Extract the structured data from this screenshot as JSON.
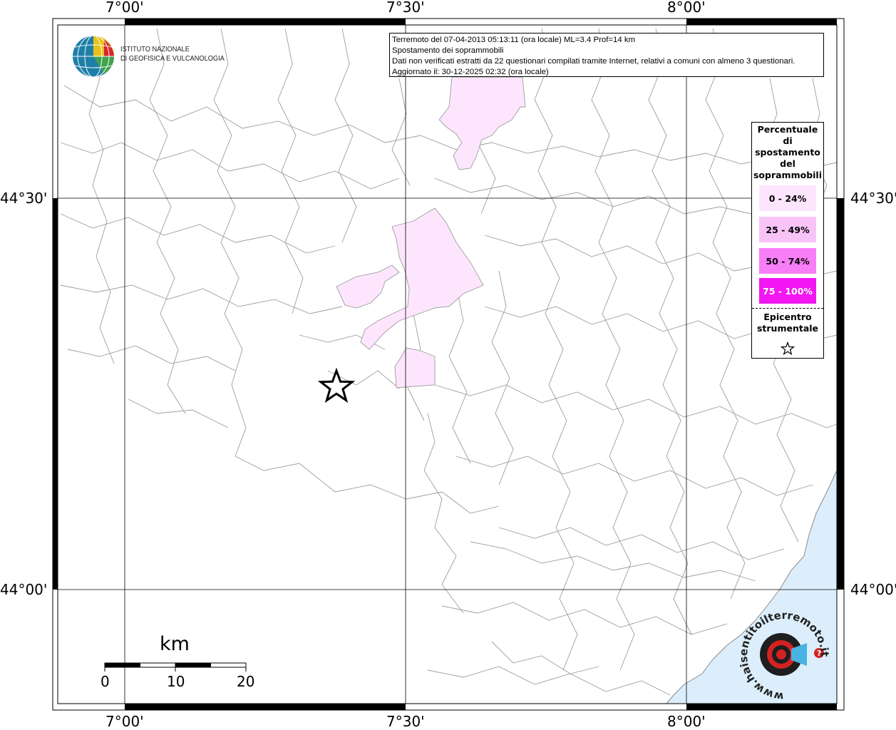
{
  "info": {
    "line1": "Terremoto del 07-04-2013 05:13:11 (ora locale) ML=3.4 Prof=14 km",
    "line2": "Spostamento dei soprammobili",
    "line3": "Dati non verificati estratti da 22 questionari compilati tramite Internet, relativi a comuni con almeno 3 questionari.",
    "line4": "Aggiornato il: 30-12-2025 02:32 (ora locale)"
  },
  "institute": {
    "line1": "ISTITUTO NAZIONALE",
    "line2": "DI GEOFISICA E VULCANOLOGIA"
  },
  "axes": {
    "top_lon": [
      "7°00'",
      "7°30'",
      "8°00'"
    ],
    "bottom_lon": [
      "7°00'",
      "7°30'",
      "8°00'"
    ],
    "left_lat": [
      "44°30'",
      "44°00'"
    ],
    "right_lat": [
      "44°30'",
      "44°00'"
    ]
  },
  "legend": {
    "title": [
      "Percentuale",
      "di",
      "spostamento",
      "del",
      "soprammobili"
    ],
    "classes": [
      {
        "label": "0 - 24%",
        "color": "#fde6fd"
      },
      {
        "label": "25 - 49%",
        "color": "#f8c4f8"
      },
      {
        "label": "50 - 74%",
        "color": "#f77ef7"
      },
      {
        "label": "75 - 100%",
        "color": "#f216f2"
      }
    ],
    "epicenter_title": [
      "Epicentro",
      "strumentale"
    ]
  },
  "scale": {
    "unit": "km",
    "ticks": [
      "0",
      "10",
      "20"
    ]
  },
  "colors": {
    "sea": "#dceefb",
    "border": "#9a9a9a",
    "grid": "#000000",
    "class_0_24": "#fde6fd"
  },
  "watermark": {
    "text": "www.haisentitoilterremoto.it ?"
  }
}
